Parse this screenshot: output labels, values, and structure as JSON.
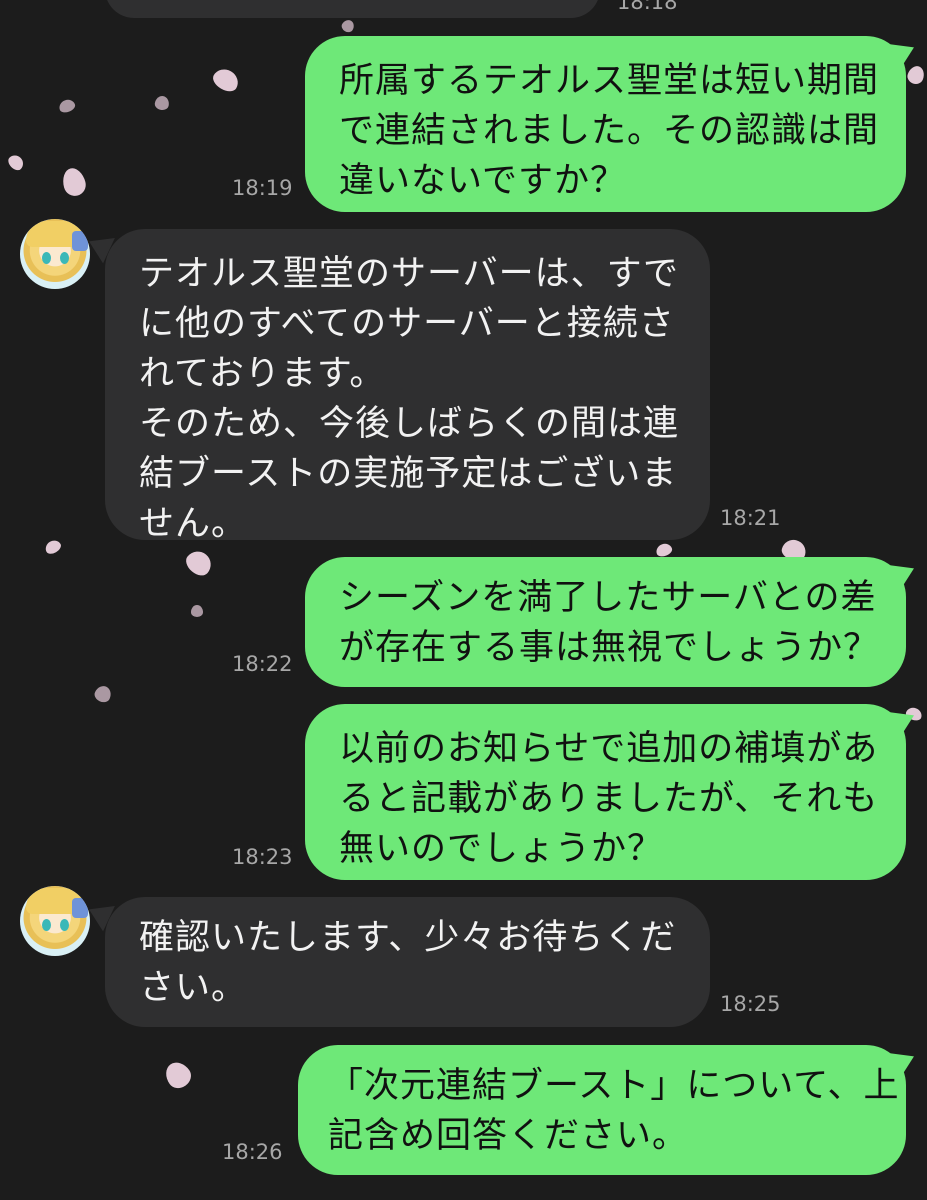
{
  "top_partial_time": "18:18",
  "messages": [
    {
      "side": "sent",
      "lines": [
        "所属するテオルス聖堂は短い期間",
        "で連結されました。その認識は間",
        "違いないですか？"
      ],
      "time": "18:19"
    },
    {
      "side": "recv",
      "lines": [
        "テオルス聖堂のサーバーは、すで",
        "に他のすべてのサーバーと接続さ",
        "れております。",
        "そのため、今後しばらくの間は連",
        "結ブーストの実施予定はございま",
        "せん。"
      ],
      "time": "18:21"
    },
    {
      "side": "sent",
      "lines": [
        "シーズンを満了したサーバとの差",
        "が存在する事は無視でしょうか？"
      ],
      "time": "18:22"
    },
    {
      "side": "sent",
      "lines": [
        "以前のお知らせで追加の補填があ",
        "ると記載がありましたが、それも",
        "無いのでしょうか？"
      ],
      "time": "18:23"
    },
    {
      "side": "recv",
      "lines": [
        "確認いたします、少々お待ちくだ",
        "さい。"
      ],
      "time": "18:25"
    },
    {
      "side": "sent",
      "lines": [
        "「次元連結ブースト」について、上",
        "記含め回答ください。"
      ],
      "time": "18:26"
    }
  ],
  "colors": {
    "background": "#1c1c1c",
    "sent_bubble": "#6ee878",
    "recv_bubble": "#2f2f30",
    "time_text": "#a7a7a7"
  },
  "icons": {
    "avatar": "character-avatar-icon",
    "decoration": "cherry-blossom-petal"
  }
}
